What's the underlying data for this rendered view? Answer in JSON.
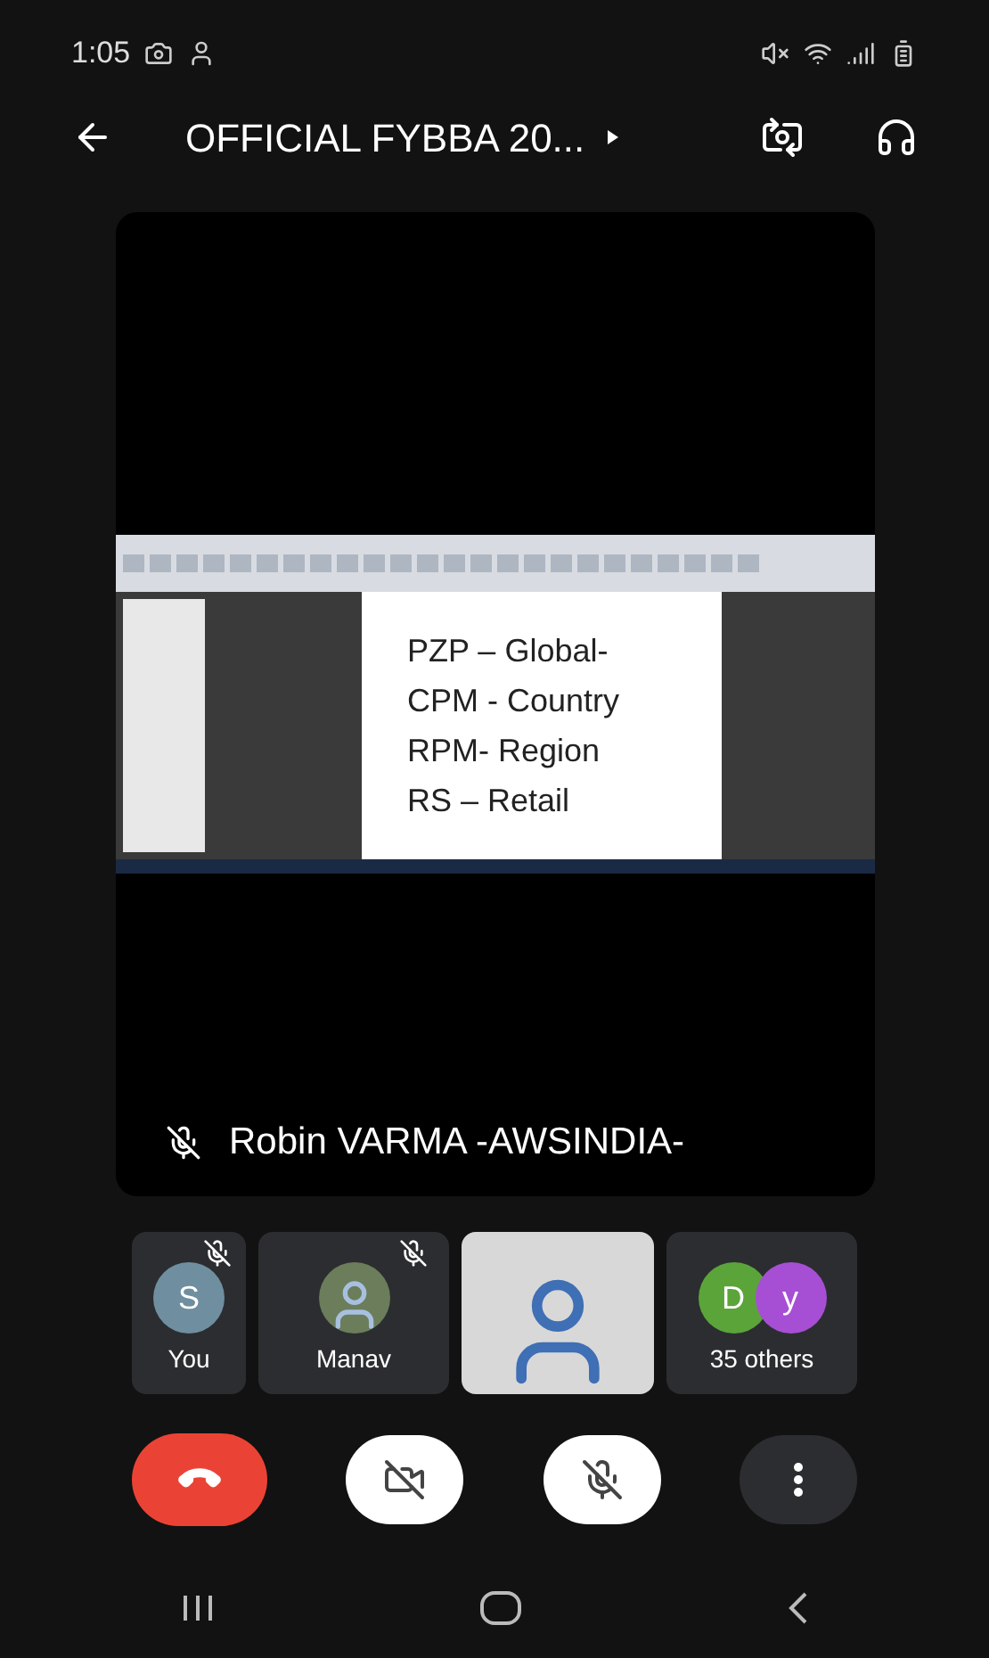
{
  "status_bar": {
    "time": "1:05"
  },
  "header": {
    "title": "OFFICIAL FYBBA 20..."
  },
  "presentation": {
    "document_lines": [
      "PZP – Global-",
      "CPM - Country",
      "RPM- Region",
      "RS – Retail"
    ],
    "presenter": {
      "name": "Robin VARMA -AWSINDIA-",
      "muted": true
    }
  },
  "participants": [
    {
      "kind": "avatar",
      "initial": "S",
      "name": "You",
      "muted": true,
      "color": "#6f8fa0"
    },
    {
      "kind": "photo",
      "name": "Manav",
      "muted": true
    },
    {
      "kind": "video"
    },
    {
      "kind": "group",
      "name": "35 others",
      "initials": [
        {
          "letter": "D",
          "color": "#5ba43a"
        },
        {
          "letter": "y",
          "color": "#a64fd4"
        }
      ]
    }
  ],
  "controls": {
    "camera_on": false,
    "mic_on": false
  }
}
